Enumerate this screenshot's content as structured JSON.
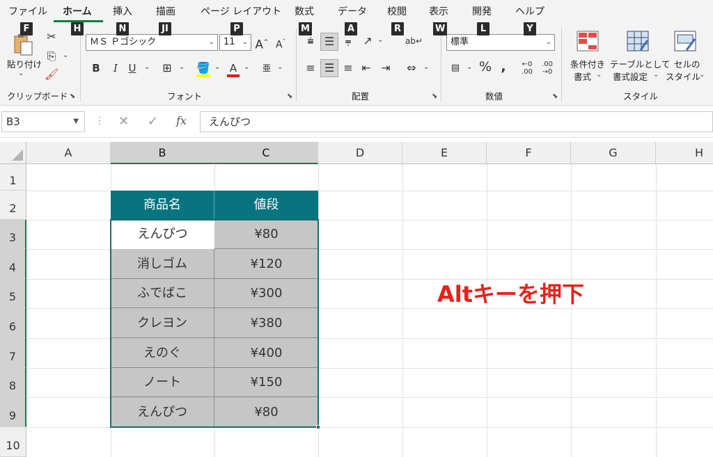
{
  "ribbon_tabs": [
    "ファイル",
    "ホーム",
    "挿入",
    "描画",
    "ページ レイアウト",
    "数式",
    "データ",
    "校閲",
    "表示",
    "開発",
    "ヘルプ"
  ],
  "keytips": [
    "F",
    "H",
    "N",
    "JI",
    "P",
    "M",
    "A",
    "R",
    "W",
    "L",
    "Y"
  ],
  "clipboard": {
    "paste_label": "貼り付け",
    "group_label": "クリップボード"
  },
  "font": {
    "name": "ＭＳ Ｐゴシック",
    "size": "11",
    "group_label": "フォント",
    "bold": "B",
    "italic": "I",
    "underline": "U",
    "font_color_glyph": "A",
    "phonetic_glyph": "亜"
  },
  "alignment": {
    "group_label": "配置"
  },
  "number": {
    "format": "標準",
    "group_label": "数値"
  },
  "styles": {
    "conditional_line1": "条件付き",
    "conditional_line2": "書式",
    "table_line1": "テーブルとして",
    "table_line2": "書式設定",
    "cell_line1": "セルの",
    "cell_line2": "スタイル",
    "group_label": "スタイル"
  },
  "formula_bar": {
    "name_box": "B3",
    "fx": "fx",
    "content": "えんぴつ"
  },
  "columns": [
    "A",
    "B",
    "C",
    "D",
    "E",
    "F",
    "G",
    "H"
  ],
  "rows": [
    "1",
    "2",
    "3",
    "4",
    "5",
    "6",
    "7",
    "8",
    "9",
    "10"
  ],
  "table": {
    "headers": [
      "商品名",
      "値段"
    ],
    "rows": [
      {
        "name": "えんぴつ",
        "price": "¥80"
      },
      {
        "name": "消しゴム",
        "price": "¥120"
      },
      {
        "name": "ふでばこ",
        "price": "¥300"
      },
      {
        "name": "クレヨン",
        "price": "¥380"
      },
      {
        "name": "えのぐ",
        "price": "¥400"
      },
      {
        "name": "ノート",
        "price": "¥150"
      },
      {
        "name": "えんぴつ",
        "price": "¥80"
      }
    ]
  },
  "annotation": {
    "text": "Altキーを押下",
    "color": "#e8211a"
  },
  "colors": {
    "accent": "#107c41",
    "table_header": "#08747f",
    "selection": "#c6c6c6"
  }
}
